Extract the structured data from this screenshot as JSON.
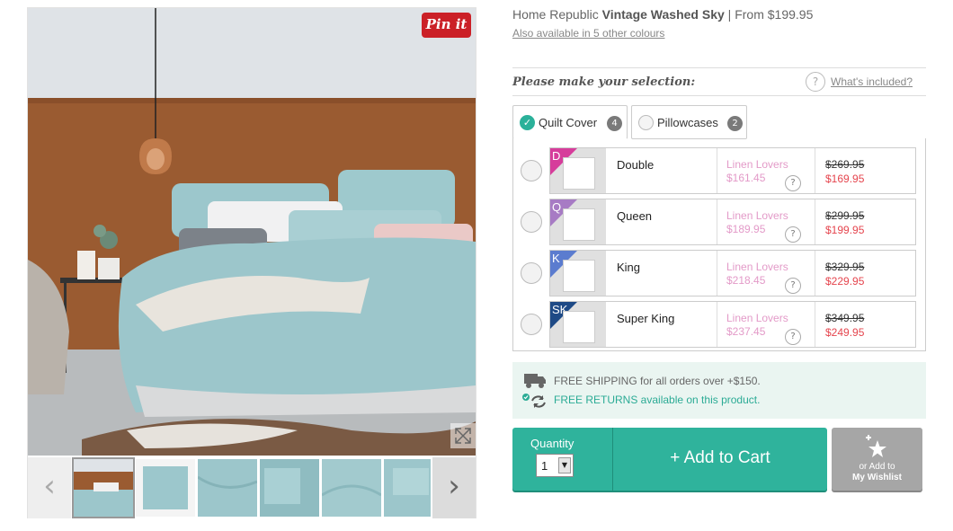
{
  "gallery": {
    "pin_label": "Pin it",
    "prev_icon": "chevron-left-icon",
    "next_icon": "chevron-right-icon",
    "zoom_icon": "expand-icon",
    "thumbnail_count": 6,
    "selected_thumbnail": 1
  },
  "product": {
    "brand": "Home Republic",
    "name": "Vintage Washed Sky",
    "price_prefix": "| From $199.95",
    "colours_link": "Also available in 5 other colours"
  },
  "selection": {
    "prompt": "Please make your selection:",
    "help_icon": "?",
    "whats_included": "What's included?"
  },
  "tabs": [
    {
      "label": "Quilt Cover",
      "count": "4",
      "active": true
    },
    {
      "label": "Pillowcases",
      "count": "2",
      "active": false
    }
  ],
  "options": [
    {
      "code": "D",
      "name": "Double",
      "member_label": "Linen Lovers",
      "member_price": "$161.45",
      "was": "$269.95",
      "now": "$169.95",
      "color": "#d63d9b"
    },
    {
      "code": "Q",
      "name": "Queen",
      "member_label": "Linen Lovers",
      "member_price": "$189.95",
      "was": "$299.95",
      "now": "$199.95",
      "color": "#a77bc4"
    },
    {
      "code": "K",
      "name": "King",
      "member_label": "Linen Lovers",
      "member_price": "$218.45",
      "was": "$329.95",
      "now": "$229.95",
      "color": "#5b7ccf"
    },
    {
      "code": "SK",
      "name": "Super King",
      "member_label": "Linen Lovers",
      "member_price": "$237.45",
      "was": "$349.95",
      "now": "$249.95",
      "color": "#1e4a86"
    }
  ],
  "shipping": {
    "line1": "FREE SHIPPING for all orders over +$150.",
    "line2": "FREE RETURNS available on this product."
  },
  "cart": {
    "quantity_label": "Quantity",
    "quantity_value": "1",
    "add_label": "+ Add to Cart",
    "wishlist_line1": "or Add to",
    "wishlist_line2": "My Wishlist"
  },
  "colors": {
    "accent": "#2fb39c",
    "sale_red": "#e5454e",
    "member_pink": "#e39ac8",
    "pinterest": "#cb2027"
  }
}
